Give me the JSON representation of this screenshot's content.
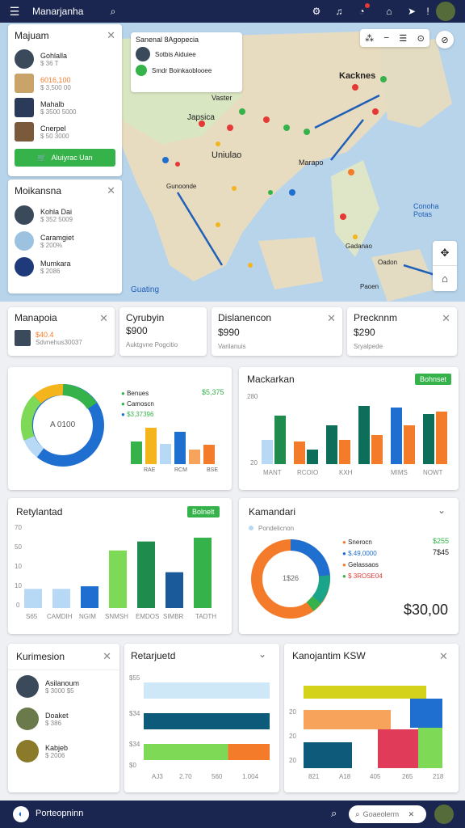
{
  "topbar": {
    "title": "Manarjanha"
  },
  "map": {
    "popup_title": "Sanenal 8Agopecia",
    "popup_line1": "Sotbis Aiduiee",
    "popup_line2": "Smdr Boinkaoblooee",
    "labels": [
      "Kacknes",
      "Japsica",
      "Vaster",
      "Uniulao",
      "Marapo",
      "Gunoonde",
      "Conoha Potas",
      "Guating",
      "Gadanao",
      "Oadon",
      "Gnopelia",
      "Paoen"
    ],
    "zoom_in_label": "+",
    "zoom_out_label": "−"
  },
  "panel_majuam": {
    "title": "Majuam",
    "items": [
      {
        "name": "Gohlalla",
        "sub": "$ 36 T"
      },
      {
        "name": "6016,100",
        "sub": "$ 3,500 00"
      },
      {
        "name": "Mahalb",
        "sub": "$ 3500 5000"
      },
      {
        "name": "Cnerpel",
        "sub": "$ 50 3000"
      }
    ],
    "button": "Aluiyrac Uan"
  },
  "panel_moikansna": {
    "title": "Moikansna",
    "items": [
      {
        "name": "Kohla Dai",
        "sub": "$ 352 5009"
      },
      {
        "name": "Caramgiet",
        "sub": "$ 200%"
      },
      {
        "name": "Mumkara",
        "sub": "$ 2086"
      }
    ]
  },
  "summary_cards": [
    {
      "title": "Manapoia",
      "value": "$40.4",
      "sub": "Sdvnehus30037",
      "has_avatar": true
    },
    {
      "title": "Cyrubyin",
      "value": "$900",
      "sub": "Auktgvne Pogcitio",
      "has_avatar": false
    },
    {
      "title": "Dislanencon",
      "value": "$990",
      "sub": "Varilanuis",
      "has_avatar": false
    },
    {
      "title": "Precknnm",
      "value": "$290",
      "sub": "Sryalpede",
      "has_avatar": false
    }
  ],
  "donut_card": {
    "center_label": "A 0100",
    "legend": [
      {
        "label": "Benues",
        "color": "#36b24a"
      },
      {
        "label": "Camoscn",
        "color": "#36b24a"
      },
      {
        "label": "$3,37396",
        "color": "#1f6fd1"
      }
    ],
    "legend_value": "$5,375",
    "bar_labels": [
      "RAE",
      "RCM",
      "BSE"
    ],
    "bars": [
      {
        "value": 28,
        "color": "#36b24a"
      },
      {
        "value": 45,
        "color": "#f3b41c"
      },
      {
        "value": 25,
        "color": "#b8d9f5"
      },
      {
        "value": 40,
        "color": "#1f6fd1"
      },
      {
        "value": 18,
        "color": "#f7a35c"
      },
      {
        "value": 24,
        "color": "#f47b2a"
      }
    ]
  },
  "macker_card": {
    "title": "Mackarkan",
    "badge": "Bohnset",
    "y_ticks": [
      "280",
      "",
      "",
      "",
      "20"
    ],
    "x_labels": [
      "MANT",
      "RCOIO",
      "KXH",
      "MIMS",
      "NOWT"
    ],
    "groups": [
      {
        "values": [
          30,
          60
        ],
        "colors": [
          "#b8d9f5",
          "#1f8b4c"
        ]
      },
      {
        "values": [
          28,
          18
        ],
        "colors": [
          "#f47b2a",
          "#0d6e5a"
        ]
      },
      {
        "values": [
          48,
          30
        ],
        "colors": [
          "#0d6e5a",
          "#f47b2a"
        ]
      },
      {
        "values": [
          72,
          36
        ],
        "colors": [
          "#0d6e5a",
          "#f47b2a"
        ]
      },
      {
        "values": [
          70,
          48
        ],
        "colors": [
          "#1f6fd1",
          "#f47b2a"
        ]
      },
      {
        "values": [
          62,
          65
        ],
        "colors": [
          "#0d6e5a",
          "#f47b2a"
        ]
      }
    ]
  },
  "rety_card": {
    "title": "Retylantad",
    "badge": "Bolnelt",
    "y_ticks": [
      "70",
      "50",
      "10",
      "10",
      "0"
    ],
    "x_labels": [
      "S65",
      "CAMDIH",
      "NGIM",
      "SNMSH",
      "EMDOS",
      "SIMBR",
      "TADTH"
    ],
    "bars": [
      {
        "value": 15,
        "color": "#b8d9f5"
      },
      {
        "value": 15,
        "color": "#b8d9f5"
      },
      {
        "value": 17,
        "color": "#1f6fd1"
      },
      {
        "value": 45,
        "color": "#7ed957"
      },
      {
        "value": 52,
        "color": "#1f8b4c"
      },
      {
        "value": 28,
        "color": "#1a5a9a"
      },
      {
        "value": 55,
        "color": "#36b24a"
      }
    ]
  },
  "kaman_card": {
    "title": "Kamandari",
    "filter": "Pondelicnon",
    "center_label": "1$26",
    "legend": [
      {
        "label": "Snerocn",
        "value": "$255",
        "color": "#f47b2a"
      },
      {
        "label": "$.49,0000",
        "value": "7$45",
        "color": "#1f6fd1"
      },
      {
        "label": "Gelassaos",
        "value": "",
        "color": "#f47b2a"
      },
      {
        "label": "$ 3ROSE04",
        "value": "",
        "color": "#36b24a"
      }
    ],
    "total": "$30,00"
  },
  "kuri_card": {
    "title": "Kurimesion",
    "items": [
      {
        "name": "Asilanoum",
        "sub": "$ 3000 $5"
      },
      {
        "name": "Doaket",
        "sub": "$ 386"
      },
      {
        "name": "Kabjeb",
        "sub": "$ 2006"
      }
    ]
  },
  "retar_card": {
    "title": "Retarjuetd",
    "y_ticks": [
      "$55",
      "$34",
      "$34",
      "$0"
    ],
    "x_labels": [
      "AJ3",
      "2.70",
      "560",
      "1.004"
    ],
    "bars": [
      {
        "segments": [
          {
            "value": 100,
            "color": "#cfe8f7"
          }
        ]
      },
      {
        "segments": [
          {
            "value": 100,
            "color": "#0d5a7a"
          }
        ]
      },
      {
        "segments": [
          {
            "value": 67,
            "color": "#7ed957"
          },
          {
            "value": 33,
            "color": "#f47b2a"
          }
        ]
      }
    ]
  },
  "kano_card": {
    "title": "Kanojantim KSW",
    "y_ticks": [
      "",
      "20",
      "20",
      "20"
    ],
    "x_labels": [
      "821",
      "A18",
      "405",
      "265",
      "218"
    ]
  },
  "bottombar": {
    "title": "Porteopninn",
    "search_placeholder": "Goaeolerm"
  }
}
